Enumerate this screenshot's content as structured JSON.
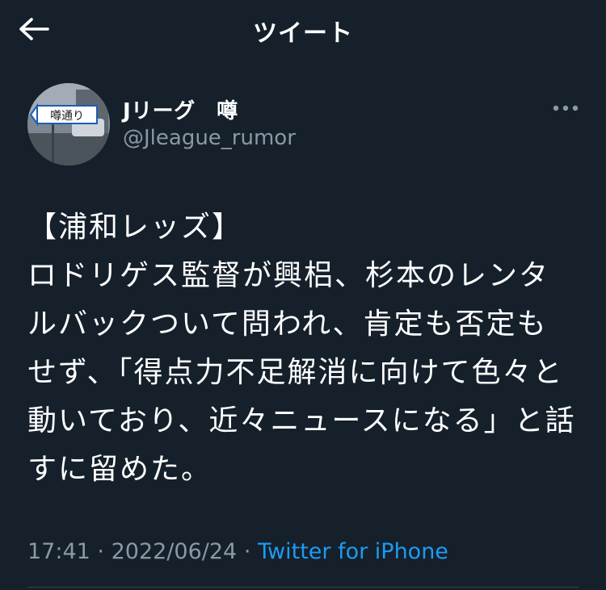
{
  "header": {
    "title": "ツイート",
    "back_icon": "arrow-left-icon"
  },
  "author": {
    "name": "Jリーグ　噂",
    "handle": "@Jleague_rumor",
    "avatar_sign_text": "噂通り"
  },
  "tweet": {
    "text": "【浦和レッズ】\nロドリゲス監督が興梠、杉本のレンタルバックついて問われ、肯定も否定もせず、「得点力不足解消に向けて色々と動いており、近々ニュースになる」と話すに留めた。"
  },
  "meta": {
    "time": "17:41",
    "separator1": "·",
    "date": "2022/06/24",
    "separator2": "·",
    "source": "Twitter for iPhone"
  },
  "colors": {
    "background": "#15202b",
    "text": "#ffffff",
    "secondary": "#8b98a5",
    "link": "#1d9bf0",
    "divider": "#38444d"
  }
}
